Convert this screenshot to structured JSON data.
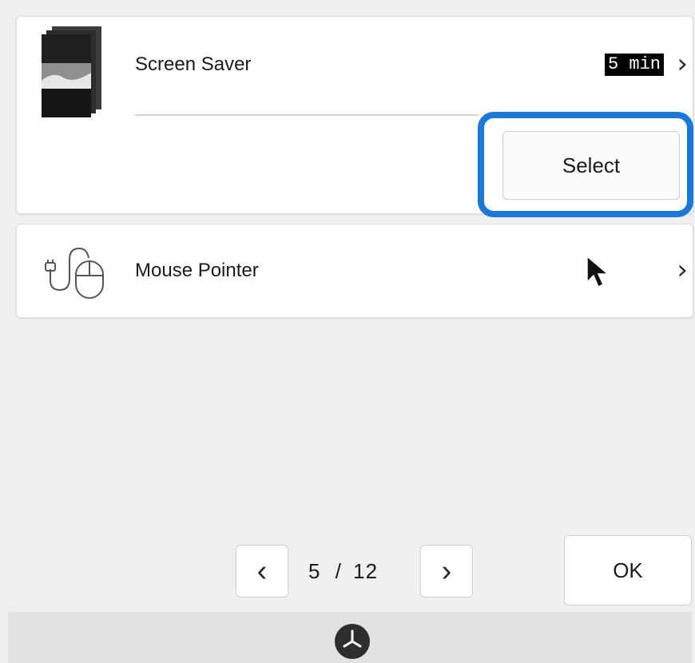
{
  "screen_saver": {
    "label": "Screen Saver",
    "value": "5 min",
    "select_label": "Select"
  },
  "mouse_pointer": {
    "label": "Mouse Pointer"
  },
  "pager": {
    "current": "5",
    "separator": "/",
    "total": "12"
  },
  "ok_label": "OK",
  "icons": {
    "screen_saver": "screen-saver-thumbnail-icon",
    "mouse": "mouse-icon",
    "cursor": "arrow-cursor-icon",
    "clock": "clock-icon",
    "prev": "chevron-left-icon",
    "next": "chevron-right-icon"
  },
  "colors": {
    "highlight": "#1a79d6",
    "background": "#efefef",
    "card": "#ffffff"
  }
}
